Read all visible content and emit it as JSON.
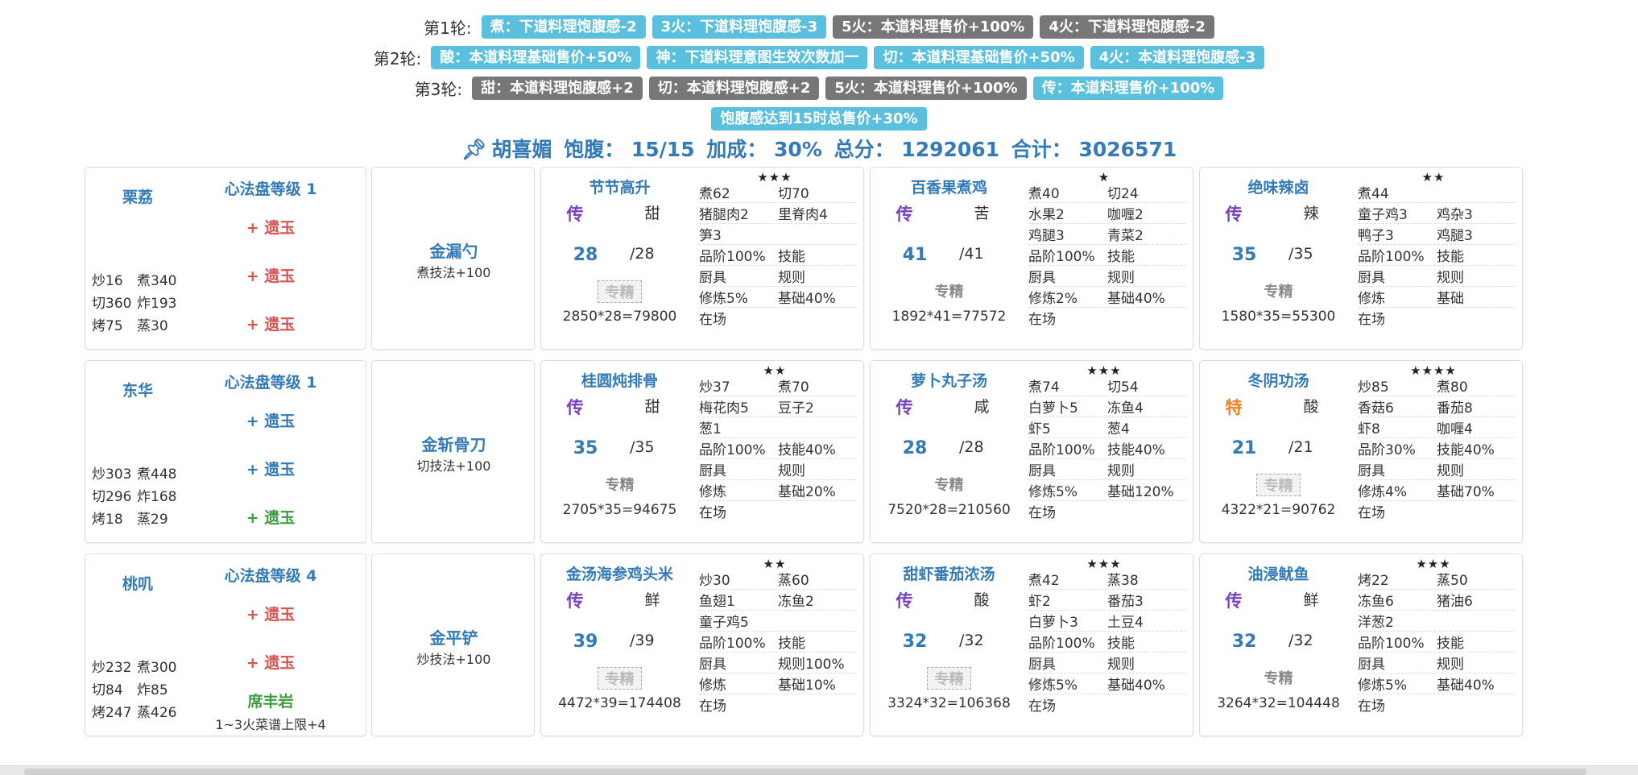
{
  "rounds": [
    {
      "label": "第1轮:",
      "tags": [
        {
          "text": "煮：下道料理饱腹感-2",
          "color": "blue"
        },
        {
          "text": "3火：下道料理饱腹感-3",
          "color": "blue"
        },
        {
          "text": "5火：本道料理售价+100%",
          "color": "grey"
        },
        {
          "text": "4火：下道料理饱腹感-2",
          "color": "grey"
        }
      ]
    },
    {
      "label": "第2轮:",
      "tags": [
        {
          "text": "酸：本道料理基础售价+50%",
          "color": "blue"
        },
        {
          "text": "神：下道料理意图生效次数加一",
          "color": "blue"
        },
        {
          "text": "切：本道料理基础售价+50%",
          "color": "blue"
        },
        {
          "text": "4火：本道料理饱腹感-3",
          "color": "blue"
        }
      ]
    },
    {
      "label": "第3轮:",
      "tags": [
        {
          "text": "甜：本道料理饱腹感+2",
          "color": "grey"
        },
        {
          "text": "切：本道料理饱腹感+2",
          "color": "grey"
        },
        {
          "text": "5火：本道料理售价+100%",
          "color": "grey"
        },
        {
          "text": "传：本道料理售价+100%",
          "color": "blue"
        }
      ]
    }
  ],
  "bonus_tag": "饱腹感达到15时总售价+30%",
  "summary": {
    "icon": "pin-icon",
    "name": "胡喜媚",
    "full": "饱腹： 15/15",
    "bonus": "加成： 30%",
    "score": "总分： 1292061",
    "total": "合计： 3026571"
  },
  "rows": [
    {
      "chef": {
        "name": "栗荔",
        "level": "心法盘等级 1",
        "jades": [
          {
            "text": "+ 遗玉",
            "color": "red"
          },
          {
            "text": "+ 遗玉",
            "color": "red"
          },
          {
            "text": "+ 遗玉",
            "color": "red"
          }
        ],
        "skills": [
          [
            "炒16",
            "煮340"
          ],
          [
            "切360",
            "炸193"
          ],
          [
            "烤75",
            "蒸30"
          ]
        ],
        "aux_name": "",
        "aux_desc": ""
      },
      "equip": {
        "name": "金漏勺",
        "desc": "煮技法+100"
      },
      "recipes": [
        {
          "name": "节节高升",
          "stars": "★★★",
          "rank": "传",
          "rank_color": "purple",
          "taste": "甜",
          "qty": "28",
          "max": "/28",
          "spec": "专精",
          "spec_ok": false,
          "calc": "2850*28=79800",
          "cells": [
            [
              "煮62",
              "切70"
            ],
            [
              "猪腿肉2",
              "里脊肉4"
            ],
            [
              "笋3",
              ""
            ],
            [
              "品阶100%",
              "技能"
            ],
            [
              "厨具",
              "规则"
            ],
            [
              "修炼5%",
              "基础40%"
            ],
            [
              "在场",
              ""
            ]
          ]
        },
        {
          "name": "百香果煮鸡",
          "stars": "★",
          "rank": "传",
          "rank_color": "purple",
          "taste": "苦",
          "qty": "41",
          "max": "/41",
          "spec": "专精",
          "spec_ok": true,
          "calc": "1892*41=77572",
          "cells": [
            [
              "煮40",
              "切24"
            ],
            [
              "水果2",
              "咖喱2"
            ],
            [
              "鸡腿3",
              "青菜2"
            ],
            [
              "品阶100%",
              "技能"
            ],
            [
              "厨具",
              "规则"
            ],
            [
              "修炼2%",
              "基础40%"
            ],
            [
              "在场",
              ""
            ]
          ]
        },
        {
          "name": "绝味辣卤",
          "stars": "★★",
          "rank": "传",
          "rank_color": "purple",
          "taste": "辣",
          "qty": "35",
          "max": "/35",
          "spec": "专精",
          "spec_ok": true,
          "calc": "1580*35=55300",
          "cells": [
            [
              "煮44",
              ""
            ],
            [
              "童子鸡3",
              "鸡杂3"
            ],
            [
              "鸭子3",
              "鸡腿3"
            ],
            [
              "品阶100%",
              "技能"
            ],
            [
              "厨具",
              "规则"
            ],
            [
              "修炼",
              "基础"
            ],
            [
              "在场",
              ""
            ]
          ]
        }
      ]
    },
    {
      "chef": {
        "name": "东华",
        "level": "心法盘等级 1",
        "jades": [
          {
            "text": "+ 遗玉",
            "color": "blue"
          },
          {
            "text": "+ 遗玉",
            "color": "blue"
          },
          {
            "text": "+ 遗玉",
            "color": "green"
          }
        ],
        "skills": [
          [
            "炒303",
            "煮448"
          ],
          [
            "切296",
            "炸168"
          ],
          [
            "烤18",
            "蒸29"
          ]
        ],
        "aux_name": "",
        "aux_desc": ""
      },
      "equip": {
        "name": "金斩骨刀",
        "desc": "切技法+100"
      },
      "recipes": [
        {
          "name": "桂圆炖排骨",
          "stars": "★★",
          "rank": "传",
          "rank_color": "purple",
          "taste": "甜",
          "qty": "35",
          "max": "/35",
          "spec": "专精",
          "spec_ok": true,
          "calc": "2705*35=94675",
          "cells": [
            [
              "炒37",
              "煮70"
            ],
            [
              "梅花肉5",
              "豆子2"
            ],
            [
              "葱1",
              ""
            ],
            [
              "品阶100%",
              "技能40%"
            ],
            [
              "厨具",
              "规则"
            ],
            [
              "修炼",
              "基础20%"
            ],
            [
              "在场",
              ""
            ]
          ]
        },
        {
          "name": "萝卜丸子汤",
          "stars": "★★★",
          "rank": "传",
          "rank_color": "purple",
          "taste": "咸",
          "qty": "28",
          "max": "/28",
          "spec": "专精",
          "spec_ok": true,
          "calc": "7520*28=210560",
          "cells": [
            [
              "煮74",
              "切54"
            ],
            [
              "白萝卜5",
              "冻鱼4"
            ],
            [
              "虾5",
              "葱4"
            ],
            [
              "品阶100%",
              "技能40%"
            ],
            [
              "厨具",
              "规则"
            ],
            [
              "修炼5%",
              "基础120%"
            ],
            [
              "在场",
              ""
            ]
          ]
        },
        {
          "name": "冬阴功汤",
          "stars": "★★★★",
          "rank": "特",
          "rank_color": "orange",
          "taste": "酸",
          "qty": "21",
          "max": "/21",
          "spec": "专精",
          "spec_ok": false,
          "calc": "4322*21=90762",
          "cells": [
            [
              "炒85",
              "煮80"
            ],
            [
              "香菇6",
              "番茄8"
            ],
            [
              "虾8",
              "咖喱4"
            ],
            [
              "品阶30%",
              "技能40%"
            ],
            [
              "厨具",
              "规则"
            ],
            [
              "修炼4%",
              "基础70%"
            ],
            [
              "在场",
              ""
            ]
          ]
        }
      ]
    },
    {
      "chef": {
        "name": "桃叽",
        "level": "心法盘等级 4",
        "jades": [
          {
            "text": "+ 遗玉",
            "color": "red"
          },
          {
            "text": "+ 遗玉",
            "color": "red"
          }
        ],
        "skills": [
          [
            "炒232",
            "煮300"
          ],
          [
            "切84",
            "炸85"
          ],
          [
            "烤247",
            "蒸426"
          ]
        ],
        "aux_name": "席丰岩",
        "aux_desc": "1~3火菜谱上限+4"
      },
      "equip": {
        "name": "金平铲",
        "desc": "炒技法+100"
      },
      "recipes": [
        {
          "name": "金汤海参鸡头米",
          "stars": "★★",
          "rank": "传",
          "rank_color": "purple",
          "taste": "鲜",
          "qty": "39",
          "max": "/39",
          "spec": "专精",
          "spec_ok": false,
          "calc": "4472*39=174408",
          "cells": [
            [
              "炒30",
              "蒸60"
            ],
            [
              "鱼翅1",
              "冻鱼2"
            ],
            [
              "童子鸡5",
              ""
            ],
            [
              "品阶100%",
              "技能"
            ],
            [
              "厨具",
              "规则100%"
            ],
            [
              "修炼",
              "基础10%"
            ],
            [
              "在场",
              ""
            ]
          ]
        },
        {
          "name": "甜虾番茄浓汤",
          "stars": "★★★",
          "rank": "传",
          "rank_color": "purple",
          "taste": "酸",
          "qty": "32",
          "max": "/32",
          "spec": "专精",
          "spec_ok": false,
          "calc": "3324*32=106368",
          "cells": [
            [
              "煮42",
              "蒸38"
            ],
            [
              "虾2",
              "番茄3"
            ],
            [
              "白萝卜3",
              "土豆4"
            ],
            [
              "品阶100%",
              "技能"
            ],
            [
              "厨具",
              "规则"
            ],
            [
              "修炼5%",
              "基础40%"
            ],
            [
              "在场",
              ""
            ]
          ]
        },
        {
          "name": "油浸鱿鱼",
          "stars": "★★★",
          "rank": "传",
          "rank_color": "purple",
          "taste": "鲜",
          "qty": "32",
          "max": "/32",
          "spec": "专精",
          "spec_ok": true,
          "calc": "3264*32=104448",
          "cells": [
            [
              "烤22",
              "蒸50"
            ],
            [
              "冻鱼6",
              "猪油6"
            ],
            [
              "洋葱2",
              ""
            ],
            [
              "品阶100%",
              "技能"
            ],
            [
              "厨具",
              "规则"
            ],
            [
              "修炼5%",
              "基础40%"
            ],
            [
              "在场",
              ""
            ]
          ]
        }
      ]
    }
  ]
}
